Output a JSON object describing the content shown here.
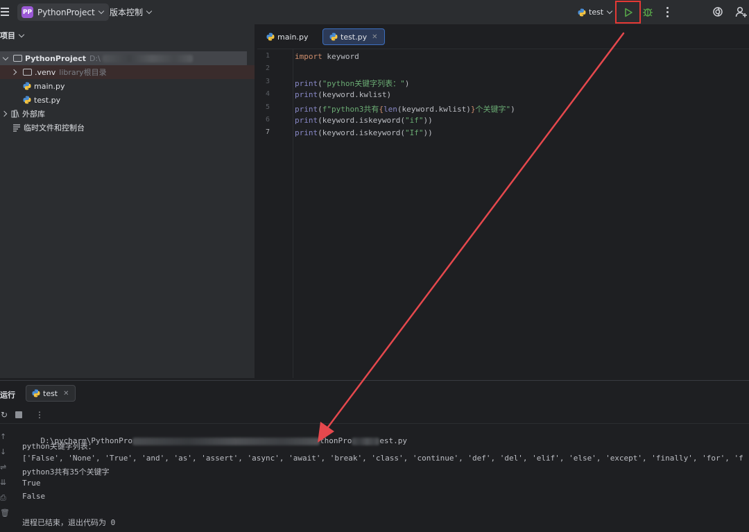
{
  "titlebar": {
    "project_badge": "PP",
    "project_name": "PythonProject",
    "vcs_label": "版本控制",
    "run_config": "test"
  },
  "project_panel": {
    "header": "项目",
    "root_name": "PythonProject",
    "root_path": "D:\\",
    "venv_name": ".venv",
    "venv_hint": "library根目录",
    "files": [
      "main.py",
      "test.py"
    ],
    "external_libs": "外部库",
    "scratches": "临时文件和控制台"
  },
  "editor": {
    "tabs": [
      "main.py",
      "test.py"
    ],
    "active_tab": "test.py",
    "line_numbers": [
      "1",
      "2",
      "3",
      "4",
      "5",
      "6",
      "7"
    ],
    "current_line": 7,
    "lines": [
      [
        {
          "t": "import",
          "c": "kw"
        },
        {
          "t": " keyword",
          "c": ""
        }
      ],
      [],
      [
        {
          "t": "print",
          "c": "bi"
        },
        {
          "t": "(",
          "c": ""
        },
        {
          "t": "\"python关键字列表：\"",
          "c": "st"
        },
        {
          "t": ")",
          "c": ""
        }
      ],
      [
        {
          "t": "print",
          "c": "bi"
        },
        {
          "t": "(keyword.kwlist)",
          "c": ""
        }
      ],
      [
        {
          "t": "print",
          "c": "bi"
        },
        {
          "t": "(",
          "c": ""
        },
        {
          "t": "f\"python3共有",
          "c": "st"
        },
        {
          "t": "{",
          "c": "kw"
        },
        {
          "t": "len",
          "c": "bi"
        },
        {
          "t": "(keyword.kwlist)",
          "c": ""
        },
        {
          "t": "}",
          "c": "kw"
        },
        {
          "t": "个关键字\"",
          "c": "st"
        },
        {
          "t": ")",
          "c": ""
        }
      ],
      [
        {
          "t": "print",
          "c": "bi"
        },
        {
          "t": "(keyword.iskeyword(",
          "c": ""
        },
        {
          "t": "\"if\"",
          "c": "st"
        },
        {
          "t": "))",
          "c": ""
        }
      ],
      [
        {
          "t": "print",
          "c": "bi"
        },
        {
          "t": "(keyword.iskeyword(",
          "c": ""
        },
        {
          "t": "\"If\"",
          "c": "st"
        },
        {
          "t": "))",
          "c": ""
        }
      ]
    ]
  },
  "run_panel": {
    "title": "运行",
    "tab": "test",
    "output": {
      "command_start": "D:\\pycharm\\PythonPro",
      "command_mid": "thonPro",
      "command_end": "est.py",
      "line1": "python关键字列表：",
      "line2": "['False', 'None', 'True', 'and', 'as', 'assert', 'async', 'await', 'break', 'class', 'continue', 'def', 'del', 'elif', 'else', 'except', 'finally', 'for', 'f",
      "line3": "python3共有35个关键字",
      "line4": "True",
      "line5": "False",
      "exit": "进程已结束，退出代码为 0"
    }
  },
  "colors": {
    "accent_red": "#e53935",
    "run_green": "#57a64a",
    "keyword": "#cf8e6d",
    "string": "#6aab73",
    "builtin": "#8888c6"
  }
}
